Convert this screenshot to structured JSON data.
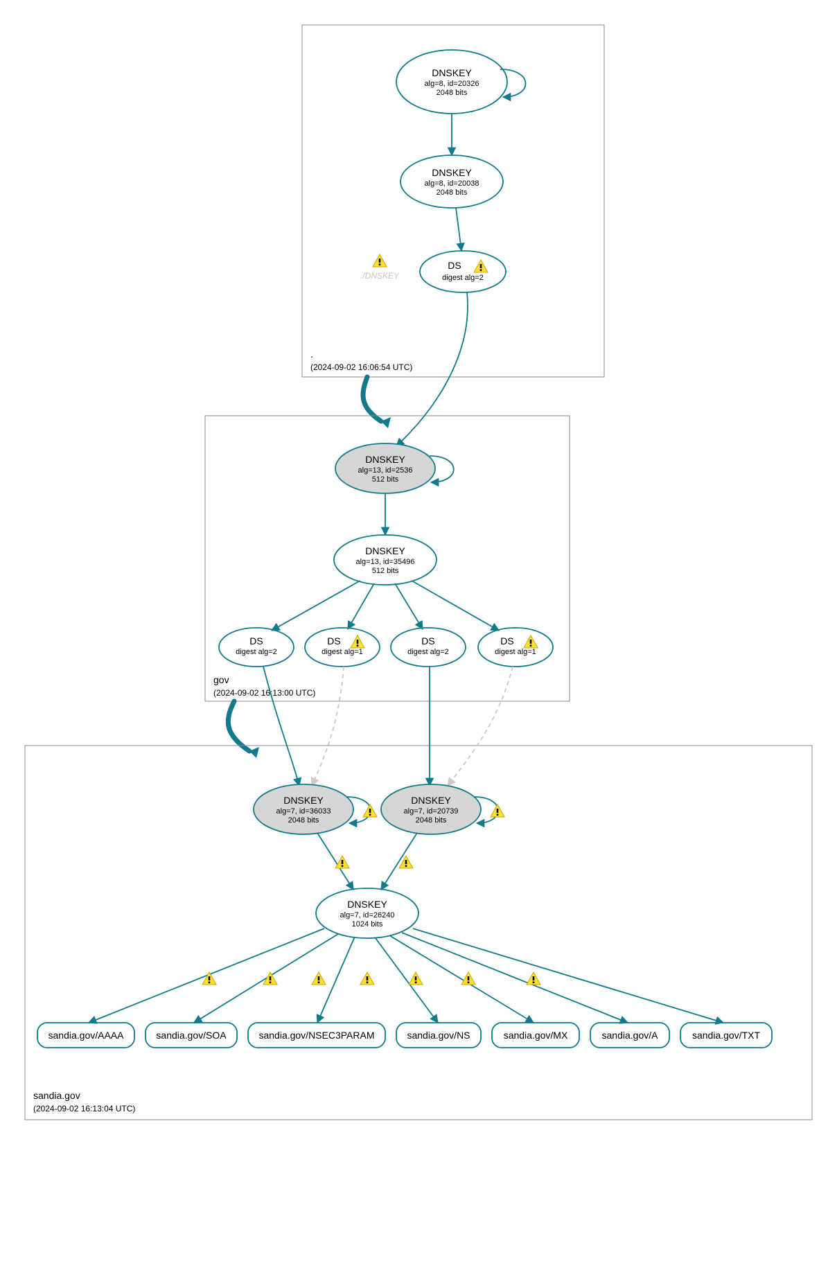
{
  "zones": {
    "root": {
      "name": ".",
      "timestamp": "(2024-09-02 16:06:54 UTC)"
    },
    "gov": {
      "name": "gov",
      "timestamp": "(2024-09-02 16:13:00 UTC)"
    },
    "sandia": {
      "name": "sandia.gov",
      "timestamp": "(2024-09-02 16:13:04 UTC)"
    }
  },
  "nodes": {
    "root_ksk": {
      "title": "DNSKEY",
      "l1": "alg=8, id=20326",
      "l2": "2048 bits"
    },
    "root_zsk": {
      "title": "DNSKEY",
      "l1": "alg=8, id=20038",
      "l2": "2048 bits"
    },
    "root_ds": {
      "title": "DS",
      "l1": "digest alg=2"
    },
    "root_ghost": {
      "l1": "./DNSKEY"
    },
    "gov_ksk": {
      "title": "DNSKEY",
      "l1": "alg=13, id=2536",
      "l2": "512 bits"
    },
    "gov_zsk": {
      "title": "DNSKEY",
      "l1": "alg=13, id=35496",
      "l2": "512 bits"
    },
    "gov_ds1": {
      "title": "DS",
      "l1": "digest alg=2"
    },
    "gov_ds2": {
      "title": "DS",
      "l1": "digest alg=1"
    },
    "gov_ds3": {
      "title": "DS",
      "l1": "digest alg=2"
    },
    "gov_ds4": {
      "title": "DS",
      "l1": "digest alg=1"
    },
    "san_ksk1": {
      "title": "DNSKEY",
      "l1": "alg=7, id=36033",
      "l2": "2048 bits"
    },
    "san_ksk2": {
      "title": "DNSKEY",
      "l1": "alg=7, id=20739",
      "l2": "2048 bits"
    },
    "san_zsk": {
      "title": "DNSKEY",
      "l1": "alg=7, id=26240",
      "l2": "1024 bits"
    }
  },
  "records": {
    "aaaa": "sandia.gov/AAAA",
    "soa": "sandia.gov/SOA",
    "nsec": "sandia.gov/NSEC3PARAM",
    "ns": "sandia.gov/NS",
    "mx": "sandia.gov/MX",
    "a": "sandia.gov/A",
    "txt": "sandia.gov/TXT"
  }
}
